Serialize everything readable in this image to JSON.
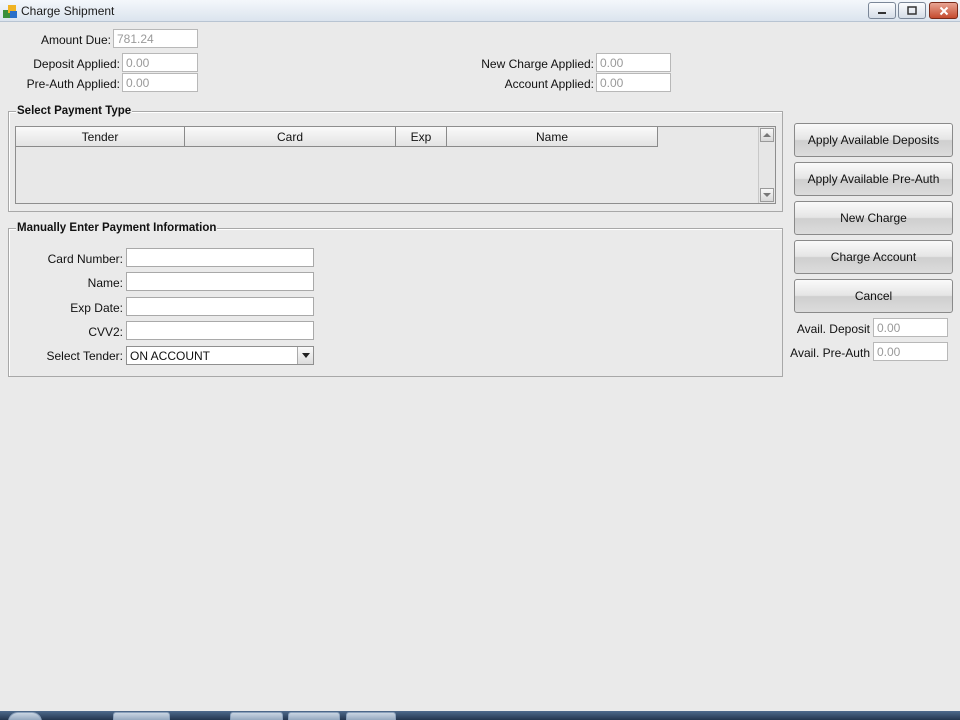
{
  "window": {
    "title": "Charge Shipment"
  },
  "summary": {
    "amount_due_label": "Amount Due:",
    "amount_due": "781.24",
    "deposit_applied_label": "Deposit Applied:",
    "deposit_applied": "0.00",
    "preauth_applied_label": "Pre-Auth Applied:",
    "preauth_applied": "0.00",
    "new_charge_applied_label": "New Charge Applied:",
    "new_charge_applied": "0.00",
    "account_applied_label": "Account Applied:",
    "account_applied": "0.00"
  },
  "payment_type": {
    "legend": "Select Payment Type",
    "columns": [
      "Tender",
      "Card",
      "Exp",
      "Name"
    ]
  },
  "manual": {
    "legend": "Manually Enter Payment Information",
    "card_number_label": "Card Number:",
    "card_number": "",
    "name_label": "Name:",
    "name": "",
    "exp_date_label": "Exp Date:",
    "exp_date": "",
    "cvv2_label": "CVV2:",
    "cvv2": "",
    "tender_label": "Select Tender:",
    "tender_value": "ON ACCOUNT"
  },
  "buttons": {
    "apply_deposits": "Apply Available Deposits",
    "apply_preauth": "Apply Available Pre-Auth",
    "new_charge": "New Charge",
    "charge_account": "Charge Account",
    "cancel": "Cancel"
  },
  "available": {
    "deposit_label": "Avail. Deposit",
    "deposit": "0.00",
    "preauth_label": "Avail. Pre-Auth",
    "preauth": "0.00"
  }
}
